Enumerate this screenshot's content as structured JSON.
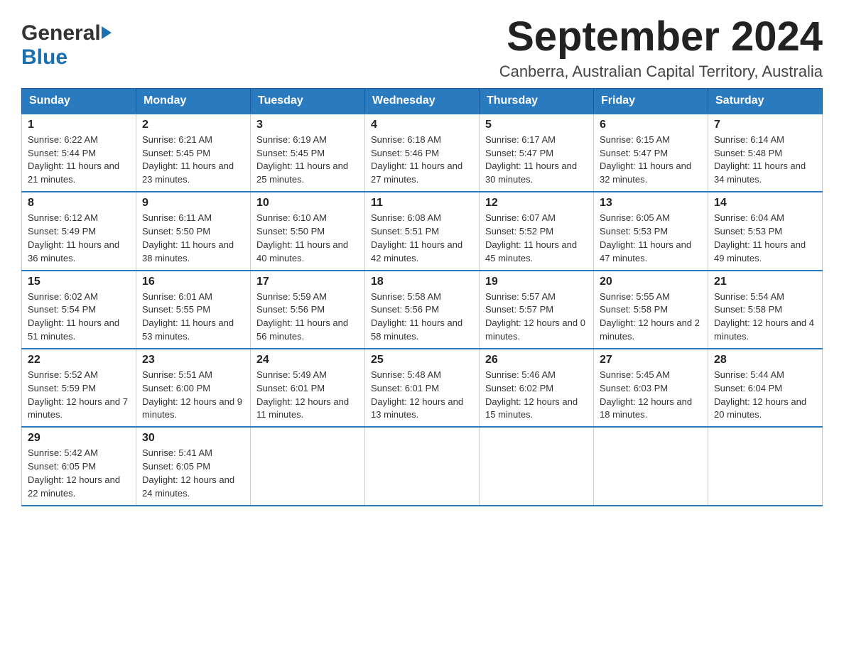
{
  "header": {
    "logo_general": "General",
    "logo_blue": "Blue",
    "month_title": "September 2024",
    "location": "Canberra, Australian Capital Territory, Australia"
  },
  "weekdays": [
    "Sunday",
    "Monday",
    "Tuesday",
    "Wednesday",
    "Thursday",
    "Friday",
    "Saturday"
  ],
  "weeks": [
    [
      {
        "day": "1",
        "sunrise": "6:22 AM",
        "sunset": "5:44 PM",
        "daylight": "11 hours and 21 minutes."
      },
      {
        "day": "2",
        "sunrise": "6:21 AM",
        "sunset": "5:45 PM",
        "daylight": "11 hours and 23 minutes."
      },
      {
        "day": "3",
        "sunrise": "6:19 AM",
        "sunset": "5:45 PM",
        "daylight": "11 hours and 25 minutes."
      },
      {
        "day": "4",
        "sunrise": "6:18 AM",
        "sunset": "5:46 PM",
        "daylight": "11 hours and 27 minutes."
      },
      {
        "day": "5",
        "sunrise": "6:17 AM",
        "sunset": "5:47 PM",
        "daylight": "11 hours and 30 minutes."
      },
      {
        "day": "6",
        "sunrise": "6:15 AM",
        "sunset": "5:47 PM",
        "daylight": "11 hours and 32 minutes."
      },
      {
        "day": "7",
        "sunrise": "6:14 AM",
        "sunset": "5:48 PM",
        "daylight": "11 hours and 34 minutes."
      }
    ],
    [
      {
        "day": "8",
        "sunrise": "6:12 AM",
        "sunset": "5:49 PM",
        "daylight": "11 hours and 36 minutes."
      },
      {
        "day": "9",
        "sunrise": "6:11 AM",
        "sunset": "5:50 PM",
        "daylight": "11 hours and 38 minutes."
      },
      {
        "day": "10",
        "sunrise": "6:10 AM",
        "sunset": "5:50 PM",
        "daylight": "11 hours and 40 minutes."
      },
      {
        "day": "11",
        "sunrise": "6:08 AM",
        "sunset": "5:51 PM",
        "daylight": "11 hours and 42 minutes."
      },
      {
        "day": "12",
        "sunrise": "6:07 AM",
        "sunset": "5:52 PM",
        "daylight": "11 hours and 45 minutes."
      },
      {
        "day": "13",
        "sunrise": "6:05 AM",
        "sunset": "5:53 PM",
        "daylight": "11 hours and 47 minutes."
      },
      {
        "day": "14",
        "sunrise": "6:04 AM",
        "sunset": "5:53 PM",
        "daylight": "11 hours and 49 minutes."
      }
    ],
    [
      {
        "day": "15",
        "sunrise": "6:02 AM",
        "sunset": "5:54 PM",
        "daylight": "11 hours and 51 minutes."
      },
      {
        "day": "16",
        "sunrise": "6:01 AM",
        "sunset": "5:55 PM",
        "daylight": "11 hours and 53 minutes."
      },
      {
        "day": "17",
        "sunrise": "5:59 AM",
        "sunset": "5:56 PM",
        "daylight": "11 hours and 56 minutes."
      },
      {
        "day": "18",
        "sunrise": "5:58 AM",
        "sunset": "5:56 PM",
        "daylight": "11 hours and 58 minutes."
      },
      {
        "day": "19",
        "sunrise": "5:57 AM",
        "sunset": "5:57 PM",
        "daylight": "12 hours and 0 minutes."
      },
      {
        "day": "20",
        "sunrise": "5:55 AM",
        "sunset": "5:58 PM",
        "daylight": "12 hours and 2 minutes."
      },
      {
        "day": "21",
        "sunrise": "5:54 AM",
        "sunset": "5:58 PM",
        "daylight": "12 hours and 4 minutes."
      }
    ],
    [
      {
        "day": "22",
        "sunrise": "5:52 AM",
        "sunset": "5:59 PM",
        "daylight": "12 hours and 7 minutes."
      },
      {
        "day": "23",
        "sunrise": "5:51 AM",
        "sunset": "6:00 PM",
        "daylight": "12 hours and 9 minutes."
      },
      {
        "day": "24",
        "sunrise": "5:49 AM",
        "sunset": "6:01 PM",
        "daylight": "12 hours and 11 minutes."
      },
      {
        "day": "25",
        "sunrise": "5:48 AM",
        "sunset": "6:01 PM",
        "daylight": "12 hours and 13 minutes."
      },
      {
        "day": "26",
        "sunrise": "5:46 AM",
        "sunset": "6:02 PM",
        "daylight": "12 hours and 15 minutes."
      },
      {
        "day": "27",
        "sunrise": "5:45 AM",
        "sunset": "6:03 PM",
        "daylight": "12 hours and 18 minutes."
      },
      {
        "day": "28",
        "sunrise": "5:44 AM",
        "sunset": "6:04 PM",
        "daylight": "12 hours and 20 minutes."
      }
    ],
    [
      {
        "day": "29",
        "sunrise": "5:42 AM",
        "sunset": "6:05 PM",
        "daylight": "12 hours and 22 minutes."
      },
      {
        "day": "30",
        "sunrise": "5:41 AM",
        "sunset": "6:05 PM",
        "daylight": "12 hours and 24 minutes."
      },
      null,
      null,
      null,
      null,
      null
    ]
  ]
}
